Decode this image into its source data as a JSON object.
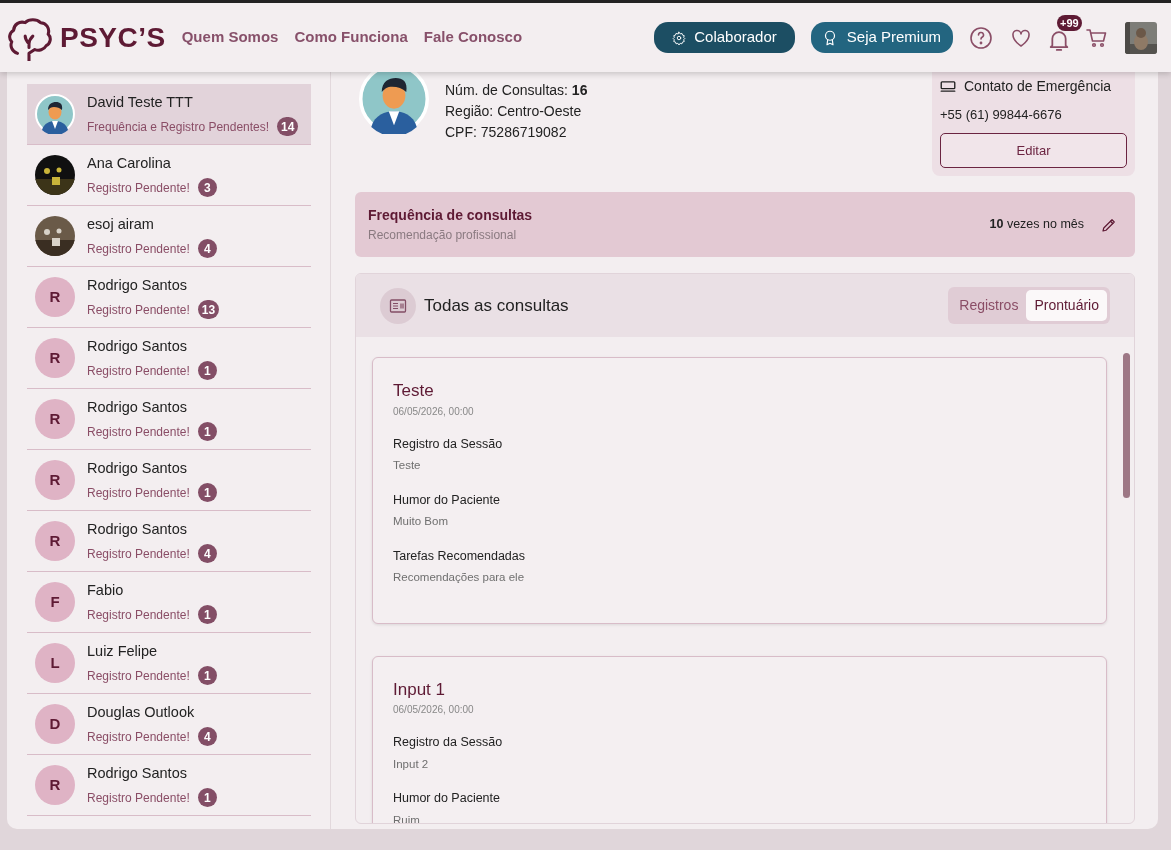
{
  "navbar": {
    "brand": "PSYC’S",
    "links": [
      "Quem Somos",
      "Como Funciona",
      "Fale Conosco"
    ],
    "collaborator_button": "Colaborador",
    "premium_button": "Seja Premium",
    "notification_count": "+99"
  },
  "patients": [
    {
      "name": "David Teste TTT",
      "status": "Frequência e Registro Pendentes!",
      "count": "14",
      "kind": "avatar",
      "selected": true
    },
    {
      "name": "Ana Carolina",
      "status": "Registro Pendente!",
      "count": "3",
      "selected": false
    },
    {
      "name": "esoj airam",
      "status": "Registro Pendente!",
      "count": "4",
      "selected": false
    },
    {
      "name": "Rodrigo Santos",
      "status": "Registro Pendente!",
      "count": "13",
      "kind": "initial",
      "initial": "R",
      "selected": false
    },
    {
      "name": "Rodrigo Santos",
      "status": "Registro Pendente!",
      "count": "1",
      "kind": "initial",
      "initial": "R",
      "selected": false
    },
    {
      "name": "Rodrigo Santos",
      "status": "Registro Pendente!",
      "count": "1",
      "kind": "initial",
      "initial": "R",
      "selected": false
    },
    {
      "name": "Rodrigo Santos",
      "status": "Registro Pendente!",
      "count": "1",
      "kind": "initial",
      "initial": "R",
      "selected": false
    },
    {
      "name": "Rodrigo Santos",
      "status": "Registro Pendente!",
      "count": "4",
      "kind": "initial",
      "initial": "R",
      "selected": false
    },
    {
      "name": "Fabio",
      "status": "Registro Pendente!",
      "count": "1",
      "kind": "initial",
      "initial": "F",
      "selected": false
    },
    {
      "name": "Luiz Felipe",
      "status": "Registro Pendente!",
      "count": "1",
      "kind": "initial",
      "initial": "L",
      "selected": false
    },
    {
      "name": "Douglas Outlook",
      "status": "Registro Pendente!",
      "count": "4",
      "kind": "initial",
      "initial": "D",
      "selected": false
    },
    {
      "name": "Rodrigo Santos",
      "status": "Registro Pendente!",
      "count": "1",
      "kind": "initial",
      "initial": "R",
      "selected": false
    }
  ],
  "profile": {
    "lines": [
      {
        "label": "Núm. de Consultas: ",
        "value": "16"
      },
      {
        "label": "Região: ",
        "value": "Centro-Oeste"
      },
      {
        "label": "CPF: ",
        "value": "75286719082"
      }
    ],
    "emergency": {
      "title": "Contato de Emergência",
      "phone": "+55 (61) 99844-6676",
      "button": "Editar"
    }
  },
  "frequency": {
    "title": "Frequência de consultas",
    "subtitle": "Recomendação profissional",
    "value": "10",
    "unit": " vezes no mês"
  },
  "consultations": {
    "title": "Todas as consultas",
    "tabs": [
      {
        "label": "Registros",
        "selected": false
      },
      {
        "label": "Prontuário",
        "selected": true
      }
    ],
    "cards": [
      {
        "title": "Teste",
        "date": "06/05/2026, 00:00",
        "fields": [
          {
            "label": "Registro da Sessão",
            "value": "Teste"
          },
          {
            "label": "Humor do Paciente",
            "value": "Muito Bom"
          },
          {
            "label": "Tarefas Recomendadas",
            "value": "Recomendações para ele"
          }
        ]
      },
      {
        "title": "Input 1",
        "date": "06/05/2026, 00:00",
        "fields": [
          {
            "label": "Registro da Sessão",
            "value": "Input 2"
          },
          {
            "label": "Humor do Paciente",
            "value": "Ruim"
          }
        ]
      }
    ]
  }
}
